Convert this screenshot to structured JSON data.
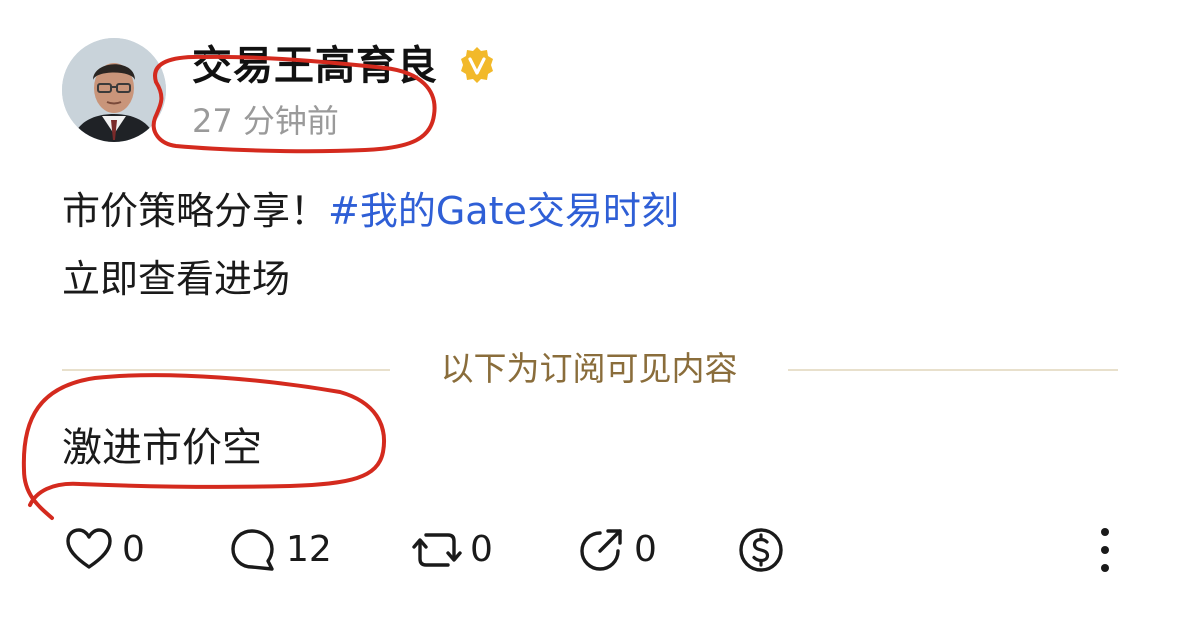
{
  "author": {
    "name": "交易王高育良",
    "posted_time": "27 分钟前",
    "verified_badge_icon": "verified-v-badge",
    "badge_color": "#f2b92a"
  },
  "post": {
    "text_prefix": "市价策略分享！",
    "hashtag": "#我的Gate交易时刻",
    "line2": "立即查看进场",
    "hashtag_color": "#2f5fd6"
  },
  "paywall": {
    "divider_label": "以下为订阅可见内容",
    "content": "激进市价空"
  },
  "actions": {
    "like_icon": "heart-icon",
    "like_count": "0",
    "comment_icon": "comment-bubble-icon",
    "comment_count": "12",
    "repost_icon": "repost-icon",
    "repost_count": "0",
    "share_icon": "share-arrow-icon",
    "share_count": "0",
    "tip_icon": "dollar-coin-icon",
    "more_icon": "more-vertical-icon"
  },
  "annotation_color": "#d42a1e"
}
